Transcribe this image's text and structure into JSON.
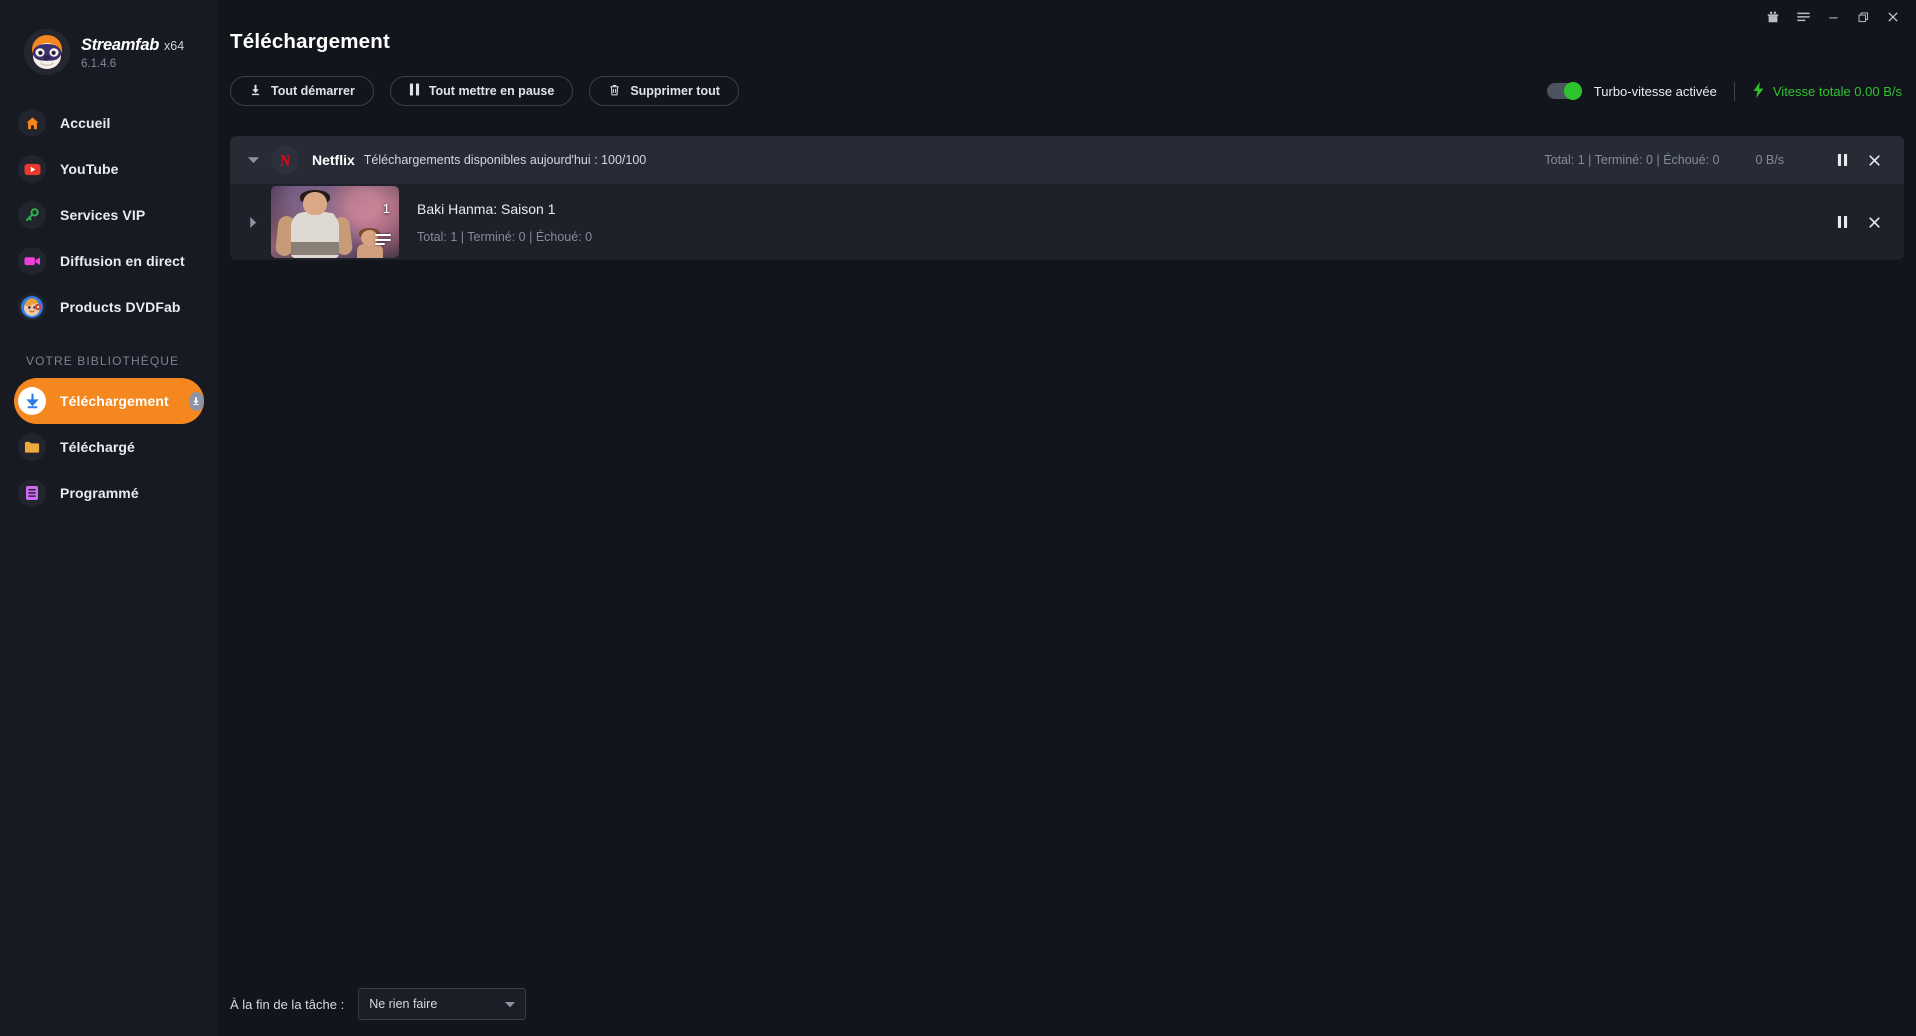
{
  "window": {
    "titlebar_icons": [
      "gift-icon",
      "menu-icon",
      "minimize-icon",
      "restore-icon",
      "close-icon"
    ]
  },
  "brand": {
    "name": "Streamfab",
    "arch": "x64",
    "version": "6.1.4.6",
    "logo_icon": "streamfab-sloth-logo"
  },
  "sidebar": {
    "items": [
      {
        "label": "Accueil",
        "icon": "home-icon",
        "color": "#f5871f",
        "active": false
      },
      {
        "label": "YouTube",
        "icon": "youtube-icon",
        "color": "#e8392f",
        "active": false
      },
      {
        "label": "Services VIP",
        "icon": "key-icon",
        "color": "#2fb24c",
        "active": false
      },
      {
        "label": "Diffusion en direct",
        "icon": "video-camera-icon",
        "color": "#ef3fd8",
        "active": false
      },
      {
        "label": "Products DVDFab",
        "icon": "dvdfab-avatar-icon",
        "color": "#2f7be8",
        "active": false
      }
    ],
    "section_title": "VOTRE BIBLIOTHÈQUE",
    "library_items": [
      {
        "label": "Téléchargement",
        "icon": "download-arrow-icon",
        "color": "#2f7be8",
        "active": true,
        "badge_icon": "download-badge-icon"
      },
      {
        "label": "Téléchargé",
        "icon": "folder-icon",
        "color": "#f0a93b",
        "active": false
      },
      {
        "label": "Programmé",
        "icon": "schedule-list-icon",
        "color": "#d06bf5",
        "active": false
      }
    ]
  },
  "header": {
    "title": "Téléchargement"
  },
  "toolbar": {
    "start_all_label": "Tout démarrer",
    "start_all_icon": "download-icon",
    "pause_all_label": "Tout mettre en pause",
    "pause_all_icon": "pause-icon",
    "delete_all_label": "Supprimer tout",
    "delete_all_icon": "trash-icon",
    "turbo_label": "Turbo-vitesse activée",
    "turbo_enabled": true,
    "turbo_color": "#2fc22f",
    "speed_icon": "lightning-bolt-icon",
    "speed_label": "Vitesse totale 0.00 B/s"
  },
  "groups": [
    {
      "provider": "Netflix",
      "provider_icon": "netflix-n-icon",
      "subtitle": "Téléchargements disponibles aujourd'hui : 100/100",
      "stats": "Total: 1  |  Terminé: 0  |  Échoué: 0",
      "speed": "0 B/s",
      "pause_icon": "pause-icon",
      "close_icon": "close-icon",
      "expanded": true,
      "tasks": [
        {
          "title": "Baki Hanma: Saison 1",
          "stats": "Total: 1  |  Terminé: 0  |  Échoué: 0",
          "thumb_count": "1",
          "thumb_icon": "episode-stack-icon",
          "pause_icon": "pause-icon",
          "close_icon": "close-icon"
        }
      ]
    }
  ],
  "footer": {
    "label": "À la fin de la tâche :",
    "select_value": "Ne rien faire",
    "select_caret_icon": "chevron-down-icon"
  }
}
